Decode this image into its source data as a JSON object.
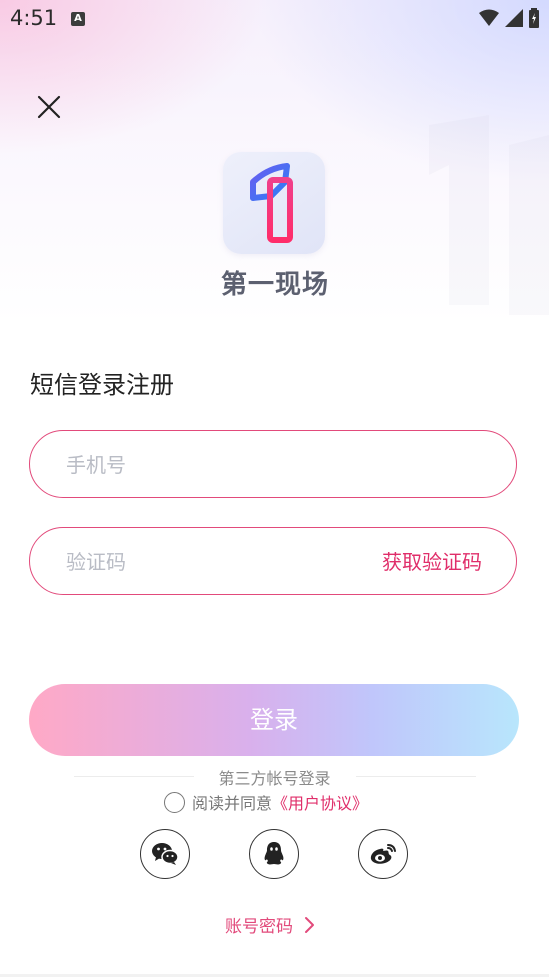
{
  "status_bar": {
    "time": "4:51",
    "notification_badge": "A"
  },
  "brand": {
    "name": "第一现场"
  },
  "form": {
    "title": "短信登录注册",
    "phone_placeholder": "手机号",
    "code_placeholder": "验证码",
    "get_code_label": "获取验证码",
    "login_label": "登录"
  },
  "third_party": {
    "label": "第三方帐号登录",
    "agree_prefix": "阅读并同意",
    "agree_link": "《用户协议》",
    "providers": [
      "wechat-icon",
      "qq-icon",
      "weibo-icon"
    ]
  },
  "account_login": {
    "label": "账号密码"
  },
  "colors": {
    "accent": "#e02e6a",
    "border": "#e24a7b"
  }
}
